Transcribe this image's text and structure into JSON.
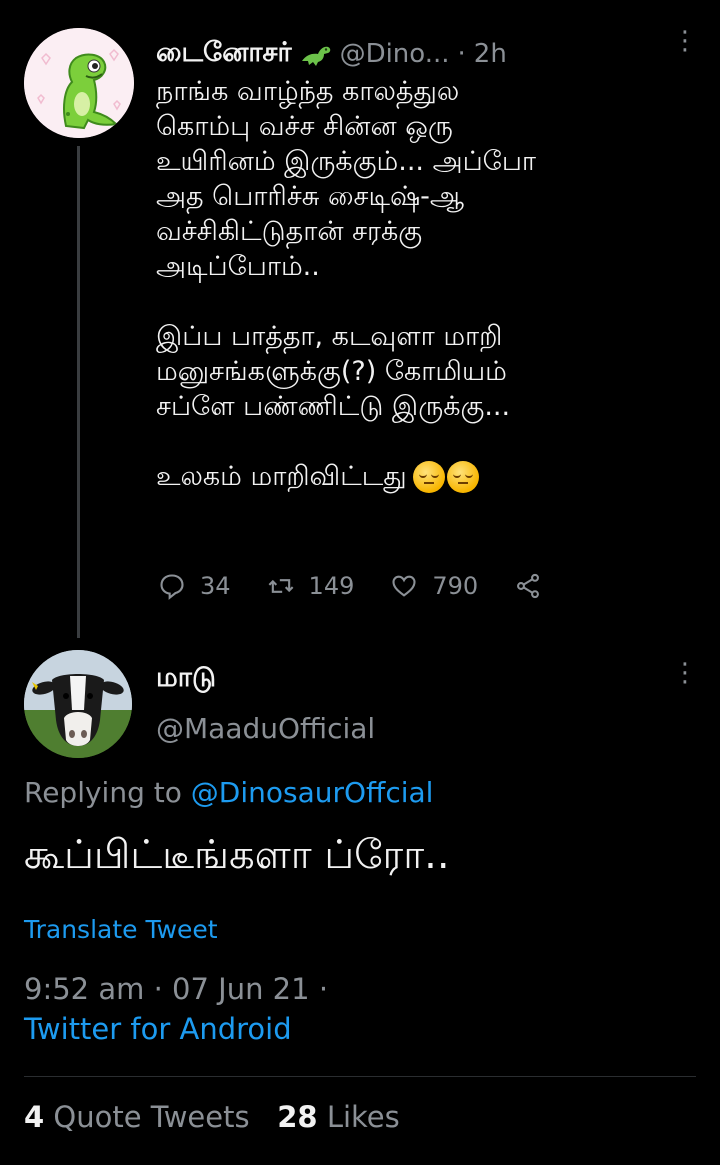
{
  "tweet": {
    "author_name": "டைனோசர்",
    "handle": "@Dino...",
    "time": "2h",
    "badge_icon": "dinosaur-emoji-icon",
    "body_lines": [
      "நாங்க வாழ்ந்த காலத்துல",
      "கொம்பு வச்ச சின்ன ஒரு",
      "உயிரினம் இருக்கும்... அப்போ",
      "அத பொரிச்சு சைடிஷ்-ஆ",
      "வச்சிகிட்டுதான் சரக்கு",
      "அடிப்போம்.."
    ],
    "body_lines_2": [
      "இப்ப பாத்தா, கடவுளா மாறி",
      "மனுசங்களுக்கு(?) கோமியம்",
      "சப்ளே பண்ணிட்டு இருக்கு..."
    ],
    "body_line_3": "உலகம் மாறிவிட்டது",
    "emoji": "pensive-face-icon",
    "actions": {
      "replies": "34",
      "retweets": "149",
      "likes": "790"
    }
  },
  "reply": {
    "author_name": "மாடு",
    "handle": "@MaaduOfficial",
    "replying_prefix": "Replying to",
    "replying_mention": "@DinosaurOffcial",
    "text": "கூப்பிட்டீங்களா ப்ரோ..",
    "translate_label": "Translate Tweet",
    "time": "9:52 am",
    "date": "07 Jun 21",
    "source": "Twitter for Android",
    "quote_count": "4",
    "quote_label": "Quote Tweets",
    "like_count": "28",
    "like_label": "Likes"
  },
  "colors": {
    "background": "#000000",
    "text": "#f2f2f2",
    "muted": "#8b9096",
    "link": "#1d9bf0"
  }
}
